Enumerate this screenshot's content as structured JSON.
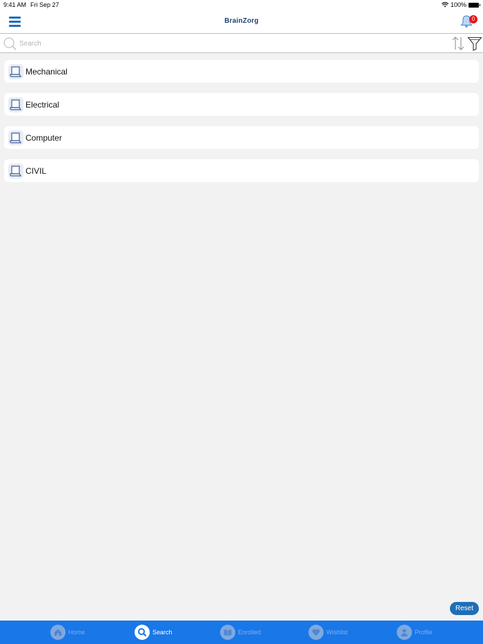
{
  "status_bar": {
    "time": "9:41 AM",
    "date": "Fri Sep 27",
    "battery": "100%"
  },
  "header": {
    "title": "BrainZorg",
    "notification_count": "0"
  },
  "search": {
    "placeholder": "Search",
    "value": ""
  },
  "categories": [
    {
      "label": "Mechanical"
    },
    {
      "label": "Electrical"
    },
    {
      "label": "Computer"
    },
    {
      "label": "CIVIL"
    }
  ],
  "reset_label": "Reset",
  "tabs": [
    {
      "label": "Home",
      "icon": "home-icon"
    },
    {
      "label": "Search",
      "icon": "search-icon"
    },
    {
      "label": "Enrolled",
      "icon": "book-icon"
    },
    {
      "label": "Wishlist",
      "icon": "heart-icon"
    },
    {
      "label": "Profile",
      "icon": "person-icon"
    }
  ],
  "active_tab": "Search",
  "colors": {
    "accent": "#1e6fb8",
    "tabbar": "#1977e8",
    "badge": "#e8141a",
    "background": "#f2f2f2"
  }
}
